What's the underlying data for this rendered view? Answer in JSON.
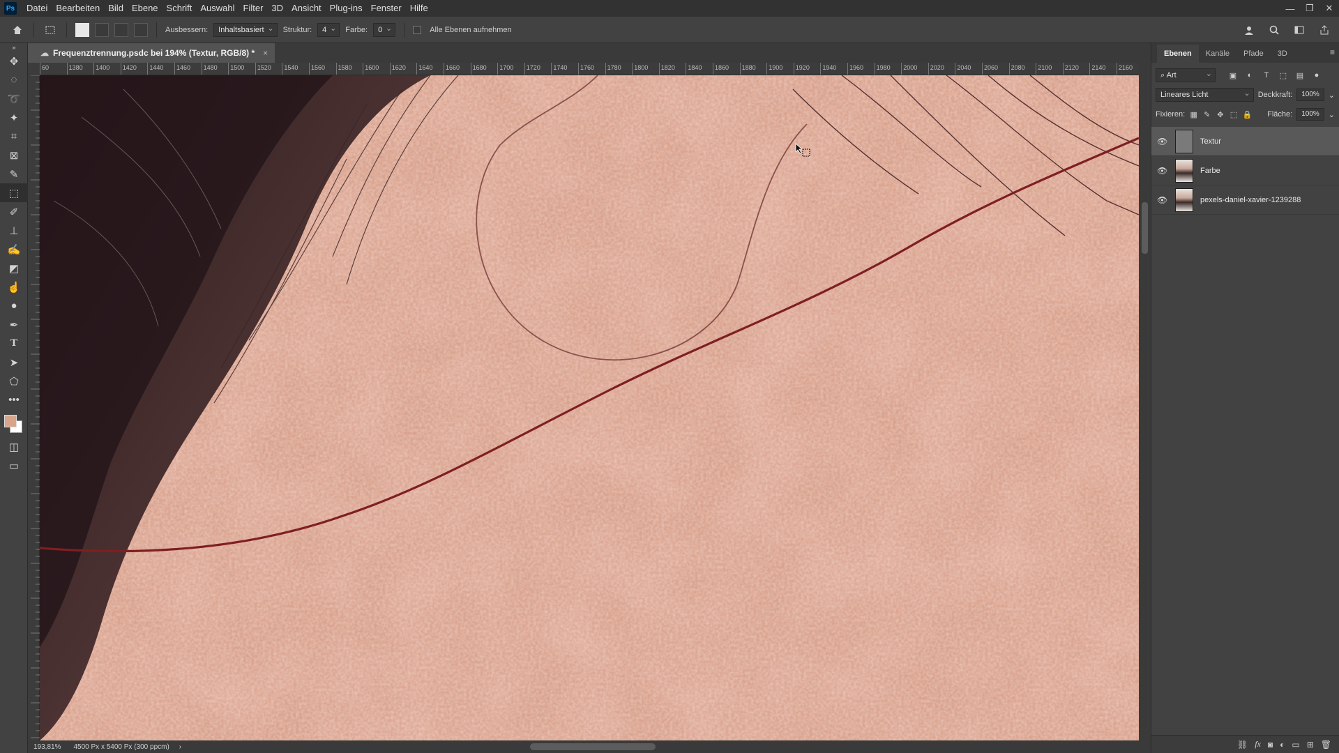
{
  "menubar": {
    "logo": "Ps",
    "items": [
      "Datei",
      "Bearbeiten",
      "Bild",
      "Ebene",
      "Schrift",
      "Auswahl",
      "Filter",
      "3D",
      "Ansicht",
      "Plug-ins",
      "Fenster",
      "Hilfe"
    ],
    "window_controls": [
      "—",
      "❐",
      "✕"
    ]
  },
  "options": {
    "ausbessern_label": "Ausbessern:",
    "ausbessern_value": "Inhaltsbasiert",
    "struktur_label": "Struktur:",
    "struktur_value": "4",
    "farbe_label": "Farbe:",
    "farbe_value": "0",
    "sample_all_label": "Alle Ebenen aufnehmen"
  },
  "document": {
    "tab_title": "Frequenztrennung.psdc bei 194% (Textur, RGB/8) *",
    "close": "×",
    "ruler_ticks": [
      "60",
      "1380",
      "1400",
      "1420",
      "1440",
      "1460",
      "1480",
      "1500",
      "1520",
      "1540",
      "1560",
      "1580",
      "1600",
      "1620",
      "1640",
      "1660",
      "1680",
      "1700",
      "1720",
      "1740",
      "1760",
      "1780",
      "1800",
      "1820",
      "1840",
      "1860",
      "1880",
      "1900",
      "1920",
      "1940",
      "1960",
      "1980",
      "2000",
      "2020",
      "2040",
      "2060",
      "2080",
      "2100",
      "2120",
      "2140",
      "2160"
    ]
  },
  "status": {
    "zoom": "193,81%",
    "doc_info": "4500 Px x 5400 Px (300 ppcm)",
    "arrow": "›"
  },
  "layers_panel": {
    "tabs": [
      "Ebenen",
      "Kanäle",
      "Pfade",
      "3D"
    ],
    "filter_value": "Art",
    "blend_mode": "Lineares Licht",
    "opacity_label": "Deckkraft:",
    "opacity_value": "100%",
    "lock_label": "Fixieren:",
    "fill_label": "Fläche:",
    "fill_value": "100%",
    "layers": [
      {
        "name": "Textur",
        "selected": true
      },
      {
        "name": "Farbe",
        "selected": false
      },
      {
        "name": "pexels-daniel-xavier-1239288",
        "selected": false
      }
    ]
  }
}
